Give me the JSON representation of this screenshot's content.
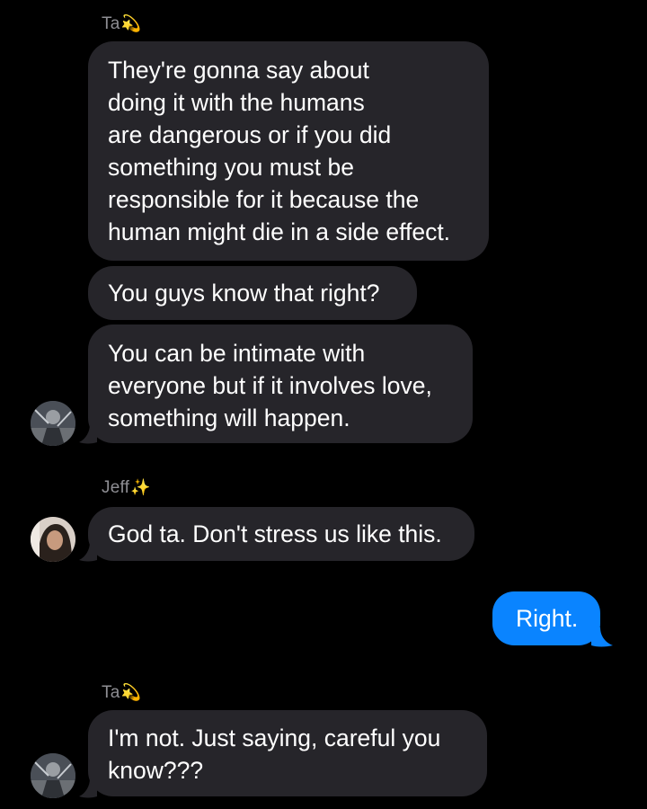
{
  "conversation": {
    "group1": {
      "sender_name": "Ta",
      "sender_emoji": "dizzy-emoji",
      "messages": [
        [
          "They're gonna say about",
          "doing it with the humans",
          "are dangerous or if you did",
          "something you must be",
          "responsible for it because the",
          "human might die in a side effect."
        ],
        [
          "You guys know that right?"
        ],
        [
          "You can be intimate with",
          "everyone but if it involves love,",
          "something will happen."
        ]
      ]
    },
    "group2": {
      "sender_name": "Jeff",
      "sender_emoji": "sparkles-emoji",
      "messages": [
        [
          "God ta. Don't stress us like this."
        ]
      ]
    },
    "outgoing": {
      "messages": [
        [
          "Right."
        ]
      ]
    },
    "group3": {
      "sender_name": "Ta",
      "sender_emoji": "dizzy-emoji",
      "messages": [
        [
          "I'm not. Just saying, careful you",
          "know???"
        ]
      ]
    }
  },
  "colors": {
    "background": "#000000",
    "incoming_bubble": "#26252a",
    "outgoing_bubble": "#0a84ff",
    "sender_name": "#8e8e93",
    "text": "#ffffff"
  }
}
